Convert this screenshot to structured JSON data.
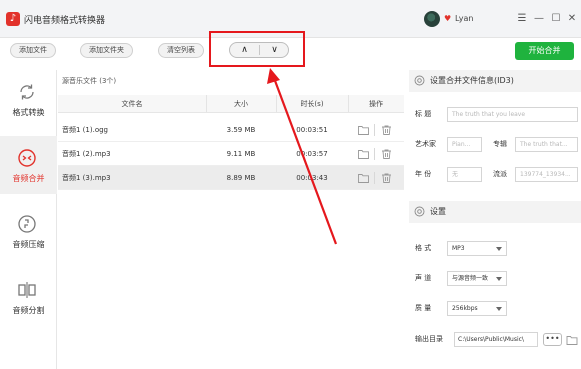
{
  "app": {
    "logo_glyph": "♪",
    "title": "闪电音频格式转换器",
    "user": {
      "vip_glyph": "♥",
      "name": "Lyan"
    },
    "window_controls": {
      "menu": "☰",
      "minimize": "—",
      "maximize": "☐",
      "close": "✕"
    }
  },
  "toolbar": {
    "add_file": "添加文件",
    "add_folder": "添加文件夹",
    "clear_list": "清空列表",
    "move_up": "∧",
    "move_down": "∨",
    "start": "开始合并"
  },
  "sidebar": {
    "items": [
      {
        "label": "格式转换",
        "icon": "refresh-icon",
        "active": false
      },
      {
        "label": "音频合并",
        "icon": "merge-icon",
        "active": true
      },
      {
        "label": "音频压缩",
        "icon": "compress-icon",
        "active": false
      },
      {
        "label": "音频分割",
        "icon": "split-icon",
        "active": false
      }
    ]
  },
  "file_list": {
    "title": "源音乐文件 (3个)",
    "columns": [
      "文件名",
      "大小",
      "时长(s)",
      "操作"
    ],
    "rows": [
      {
        "name": "音频1 (1).ogg",
        "size": "3.59 MB",
        "duration": "00:03:51",
        "selected": false
      },
      {
        "name": "音频1 (2).mp3",
        "size": "9.11 MB",
        "duration": "00:03:57",
        "selected": false
      },
      {
        "name": "音频1 (3).mp3",
        "size": "8.89 MB",
        "duration": "00:03:43",
        "selected": true
      }
    ],
    "row_actions": [
      "folder-icon",
      "trash-icon"
    ]
  },
  "id3_panel": {
    "heading": "设置合并文件信息(ID3)",
    "title_label": "标  题",
    "title_placeholder": "The truth that you leave",
    "artist_label": "艺术家",
    "artist_placeholder": "Pian...",
    "album_label": "专辑",
    "album_placeholder": "The truth that...",
    "year_label": "年  份",
    "year_placeholder": "无",
    "genre_label": "流派",
    "genre_placeholder": "139774_13934..."
  },
  "settings_panel": {
    "heading": "设置",
    "format_label": "格  式",
    "format_value": "MP3",
    "channel_label": "声  道",
    "channel_value": "与源音频一致",
    "quality_label": "质  量",
    "quality_value": "256kbps",
    "output_label": "输出目录",
    "output_value": "C:\\Users\\Public\\Music\\",
    "browse_label": "•••"
  },
  "colors": {
    "brand_red": "#e2322b",
    "start_green": "#1fb33e",
    "annotation_red": "#e5181d"
  }
}
